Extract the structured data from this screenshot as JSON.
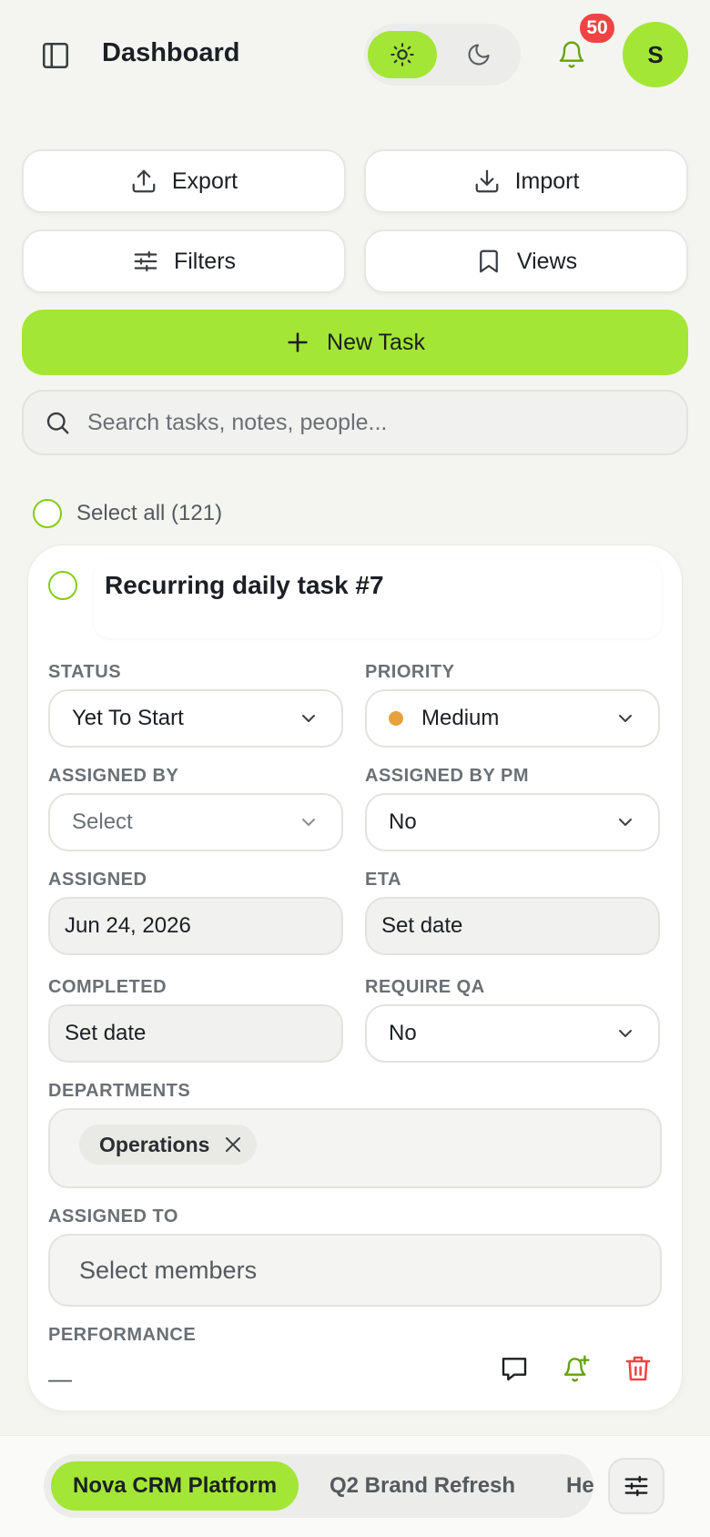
{
  "header": {
    "title": "Dashboard",
    "notifications_count": "50",
    "avatar_initial": "S",
    "theme": "light"
  },
  "toolbar": {
    "export_label": "Export",
    "import_label": "Import",
    "filters_label": "Filters",
    "views_label": "Views",
    "new_task_label": "New Task"
  },
  "search": {
    "placeholder": "Search tasks, notes, people...",
    "value": ""
  },
  "select_all_label": "Select all (121)",
  "task": {
    "title": "Recurring daily task #7",
    "status": {
      "label": "STATUS",
      "value": "Yet To Start"
    },
    "priority": {
      "label": "PRIORITY",
      "value": "Medium",
      "dot_color": "#e6a23c"
    },
    "assigned_by": {
      "label": "ASSIGNED BY",
      "value": "Select"
    },
    "assigned_by_pm": {
      "label": "ASSIGNED BY PM",
      "value": "No"
    },
    "assigned": {
      "label": "ASSIGNED",
      "value": "Jun 24, 2026"
    },
    "eta": {
      "label": "ETA",
      "value": "Set date"
    },
    "completed": {
      "label": "COMPLETED",
      "value": "Set date"
    },
    "require_qa": {
      "label": "REQUIRE QA",
      "value": "No"
    },
    "departments": {
      "label": "DEPARTMENTS",
      "chips": [
        "Operations"
      ]
    },
    "assigned_to": {
      "label": "ASSIGNED TO",
      "placeholder": "Select members"
    },
    "performance": {
      "label": "PERFORMANCE",
      "value": "—"
    }
  },
  "projects": {
    "tabs": [
      "Nova CRM Platform",
      "Q2 Brand Refresh",
      "He"
    ],
    "active": "Nova CRM Platform"
  },
  "colors": {
    "accent": "#a3e635",
    "accent_dark": "#84cc16",
    "danger": "#ef4444",
    "background": "#f4f5f1"
  },
  "icons": {
    "sidebar": "sidebar-icon",
    "sun": "sun-icon",
    "moon": "moon-icon",
    "bell": "bell-icon",
    "export": "upload-icon",
    "import": "download-icon",
    "filters": "sliders-icon",
    "views": "bookmark-icon",
    "plus": "plus-icon",
    "search": "search-icon",
    "comment": "comment-icon",
    "reminder": "bell-plus-icon",
    "delete": "trash-icon",
    "settings": "sliders-icon"
  }
}
